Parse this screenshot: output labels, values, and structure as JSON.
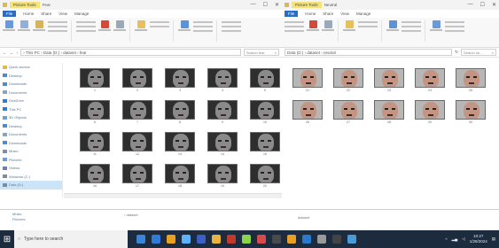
{
  "colors": {
    "ribbon_file_tab": "#2b6cc4",
    "tools_tab": "#f4e37a",
    "taskbar": "#1c2b3e",
    "selected_nav": "#cce4f7"
  },
  "left_window": {
    "tools_tab": "Picture Tools",
    "title": "Fear",
    "controls": [
      "—",
      "☐",
      "✕"
    ],
    "ribbon_tabs": [
      "File",
      "Home",
      "Share",
      "View",
      "Manage"
    ],
    "address": "› This PC › Data (D:) › dataset › fear",
    "search_placeholder": "Search fear",
    "nav_items": [
      {
        "label": "Quick access",
        "color": "#e6b84a"
      },
      {
        "label": "Desktop",
        "color": "#4a8ad6"
      },
      {
        "label": "Downloads",
        "color": "#4a8ad6"
      },
      {
        "label": "Documents",
        "color": "#8aa4c0"
      },
      {
        "label": "OneDrive",
        "color": "#2f7bd9"
      },
      {
        "label": "This PC",
        "color": "#2f7bd9"
      },
      {
        "label": "3D Objects",
        "color": "#6aa0d8"
      },
      {
        "label": "Desktop",
        "color": "#4a8ad6"
      },
      {
        "label": "Documents",
        "color": "#8aa4c0"
      },
      {
        "label": "Downloads",
        "color": "#4a8ad6"
      },
      {
        "label": "Music",
        "color": "#7a8fb0"
      },
      {
        "label": "Pictures",
        "color": "#6aa0d8"
      },
      {
        "label": "Videos",
        "color": "#6a7fb0"
      },
      {
        "label": "Windows (C:)",
        "color": "#7d8da0"
      },
      {
        "label": "Data (D:)",
        "color": "#7d8da0"
      }
    ],
    "selected_nav": 14,
    "thumbs": [
      "1",
      "2",
      "3",
      "4",
      "5",
      "6",
      "7",
      "8",
      "9",
      "10",
      "11",
      "12",
      "13",
      "14",
      "15",
      "16",
      "17",
      "18",
      "19",
      "20"
    ]
  },
  "right_window": {
    "tools_tab": "Picture Tools",
    "title": "Neutral",
    "controls": [
      "—",
      "☐",
      "✕"
    ],
    "ribbon_tabs": [
      "File",
      "Home",
      "Share",
      "View",
      "Manage"
    ],
    "address": "Data (D:) › dataset › neutral",
    "search_placeholder": "Search ne...",
    "thumbs": [
      "21",
      "22",
      "23",
      "24",
      "25",
      "26",
      "27",
      "28",
      "29",
      "30"
    ]
  },
  "bottom_strip": {
    "items": [
      "Music",
      "Pictures"
    ],
    "path": "› dataset",
    "path_right": "dataset"
  },
  "taskbar": {
    "search_text": "Type here to search",
    "icons": [
      "#3c84d8",
      "#2f7bd9",
      "#e6a11e",
      "#5cb3ff",
      "#3b5fc4",
      "#e8b63c",
      "#c0392b",
      "#8ad44a",
      "#d84a4a",
      "#4a4a4a",
      "#e8a020",
      "#2a7acc",
      "#9a9a9a",
      "#444",
      "#4a9ad8"
    ],
    "time": "10:27",
    "date": "1/28/2024"
  }
}
